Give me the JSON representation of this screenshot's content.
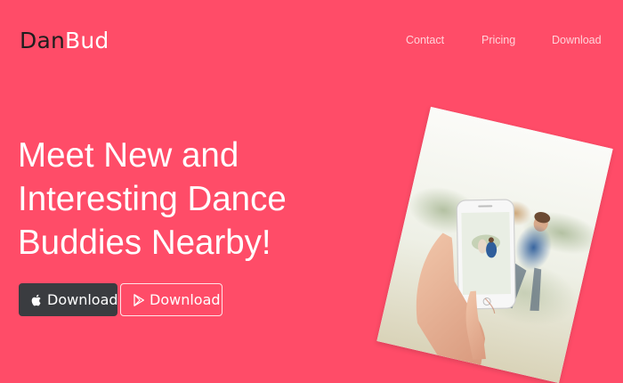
{
  "brand": {
    "part1": "Dan",
    "part2": "Bud"
  },
  "nav": {
    "contact": "Contact",
    "pricing": "Pricing",
    "download": "Download"
  },
  "hero": {
    "headline_line1": "Meet New and",
    "headline_line2": "Interesting Dance",
    "headline_line3": "Buddies Nearby!"
  },
  "buttons": {
    "apple": {
      "label": "Download",
      "icon": "apple-icon"
    },
    "play": {
      "label": "Download",
      "icon": "play-store-icon"
    }
  },
  "colors": {
    "background": "#ff4c68",
    "apple_button": "#3a3c40",
    "brand_dark": "#1e1e1e",
    "nav_text": "#ffd3da"
  }
}
